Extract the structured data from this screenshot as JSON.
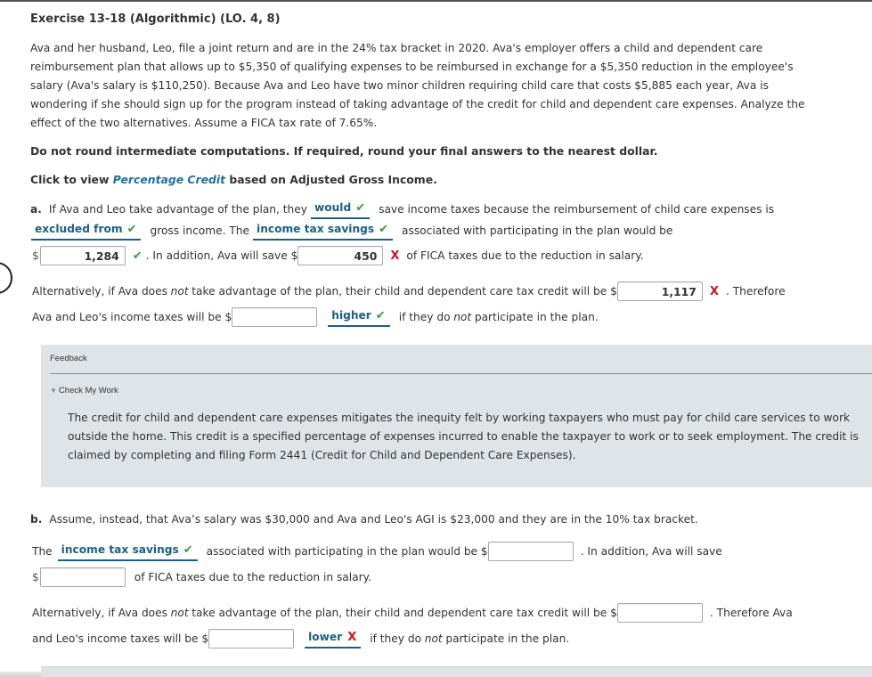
{
  "exercise": {
    "title": "Exercise 13-18 (Algorithmic) (LO. 4, 8)",
    "intro": "Ava and her husband, Leo, file a joint return and are in the 24% tax bracket in 2020. Ava's employer offers a child and dependent care reimbursement plan that allows up to $5,350 of qualifying expenses to be reimbursed in exchange for a $5,350 reduction in the employee's salary (Ava's salary is $110,250). Because Ava and Leo have two minor children requiring child care that costs $5,885 each year, Ava is wondering if she should sign up for the program instead of taking advantage of the credit for child and dependent care expenses. Analyze the effect of the two alternatives. Assume a FICA tax rate of 7.65%.",
    "rounding_note": "Do not round intermediate computations. If required, round your final answers to the nearest dollar.",
    "click_prefix": "Click to view ",
    "click_link": "Percentage Credit",
    "click_suffix": " based on Adjusted Gross Income."
  },
  "part_a": {
    "label": "a.",
    "line1_pre": "If Ava and Leo take advantage of the plan, they",
    "dd_would": {
      "value": "would",
      "status": "correct"
    },
    "line1_post": "save income taxes because the reimbursement of child care expenses is",
    "dd_excluded": {
      "value": "excluded from",
      "status": "correct"
    },
    "line2_mid": "gross income. The",
    "dd_savings": {
      "value": "income tax savings",
      "status": "correct"
    },
    "line2_post": "associated with participating in the plan would be",
    "dollar": "$",
    "savings_input": {
      "value": "1,284",
      "status": "correct"
    },
    "line3_mid": ". In addition, Ava will save $",
    "fica_input": {
      "value": "450",
      "status": "incorrect"
    },
    "line3_post": "of FICA taxes due to the reduction in salary.",
    "alt_line1_pre": "Alternatively, if Ava does ",
    "alt_not": "not",
    "alt_line1_post": " take advantage of the plan, their child and dependent care tax credit will be $",
    "credit_input": {
      "value": "1,117",
      "status": "incorrect"
    },
    "alt_line1_end": ". Therefore",
    "alt_line2_pre": "Ava and Leo's income taxes will be $",
    "taxes_input": {
      "value": "",
      "status": ""
    },
    "dd_higher": {
      "value": "higher",
      "status": "correct"
    },
    "alt_line2_post_pre": "if they do ",
    "alt_line2_not": "not",
    "alt_line2_post": " participate in the plan."
  },
  "feedback": {
    "title": "Feedback",
    "toggle": "Check My Work",
    "text": "The credit for child and dependent care expenses mitigates the inequity felt by working taxpayers who must pay for child care services to work outside the home. This credit is a specified percentage of expenses incurred to enable the taxpayer to work or to seek employment. The credit is claimed by completing and filing Form 2441 (Credit for Child and Dependent Care Expenses)."
  },
  "part_b": {
    "label": "b.",
    "intro": "Assume, instead, that Ava’s salary was $30,000 and Ava and Leo's AGI is $23,000 and they are in the 10% tax bracket.",
    "line1_pre": "The",
    "dd_savings": {
      "value": "income tax savings",
      "status": "correct"
    },
    "line1_mid": "associated with participating in the plan would be $",
    "savings_input": {
      "value": "",
      "status": ""
    },
    "line1_post": ". In addition, Ava will save",
    "dollar": "$",
    "fica_input": {
      "value": "",
      "status": ""
    },
    "line2_post": "of FICA taxes due to the reduction in salary.",
    "alt_line1_pre": "Alternatively, if Ava does ",
    "alt_not": "not",
    "alt_line1_post": " take advantage of the plan, their child and dependent care tax credit will be $",
    "credit_input": {
      "value": "",
      "status": ""
    },
    "alt_line1_end": ". Therefore Ava",
    "alt_line2_pre": "and Leo's income taxes will be $",
    "taxes_input": {
      "value": "",
      "status": ""
    },
    "dd_lower": {
      "value": "lower",
      "status": "incorrect"
    },
    "alt_line2_post_pre": "if they do ",
    "alt_line2_not": "not",
    "alt_line2_post": " participate in the plan."
  },
  "marks": {
    "correct": "✔",
    "incorrect": "X"
  },
  "colors": {
    "correct": "#3a9b3a",
    "incorrect": "#d0161b",
    "dropdown": "#1d5f82",
    "link": "#1f6fa0",
    "feedback_bg": "#dfe4e8"
  }
}
